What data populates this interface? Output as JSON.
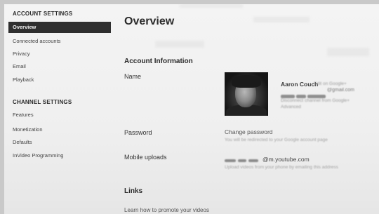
{
  "sidebar": {
    "account_settings_title": "ACCOUNT SETTINGS",
    "account_items": [
      {
        "label": "Overview",
        "active": true
      },
      {
        "label": "Connected accounts",
        "active": false
      },
      {
        "label": "Privacy",
        "active": false
      },
      {
        "label": "Email",
        "active": false
      },
      {
        "label": "Playback",
        "active": false
      }
    ],
    "channel_settings_title": "CHANNEL SETTINGS",
    "channel_items": [
      {
        "label": "Features"
      },
      {
        "label": "Monetization"
      },
      {
        "label": "Defaults"
      },
      {
        "label": "InVideo Programming"
      }
    ]
  },
  "main": {
    "title": "Overview",
    "account_info_heading": "Account Information",
    "name_label": "Name",
    "user_name": "Aaron Couch",
    "edit_on_google": "Edit on Google+",
    "email_suffix": "@gmail.com",
    "disconnect_text": "Disconnect channel from Google+",
    "advanced_link": "Advanced",
    "password_label": "Password",
    "change_password_link": "Change password",
    "password_hint": "You will be redirected to your Google account page",
    "mobile_uploads_label": "Mobile uploads",
    "mobile_email_suffix": "@m.youtube.com",
    "mobile_hint": "Upload videos from your phone by emailing this address",
    "links_heading": "Links",
    "promote_link": "Learn how to promote your videos"
  },
  "colors": {
    "active_nav_bg": "#2f2f2f",
    "active_nav_text": "#f2f2f2",
    "page_bg": "#f2f2f2"
  },
  "icons": {
    "avatar": "user-photo"
  }
}
